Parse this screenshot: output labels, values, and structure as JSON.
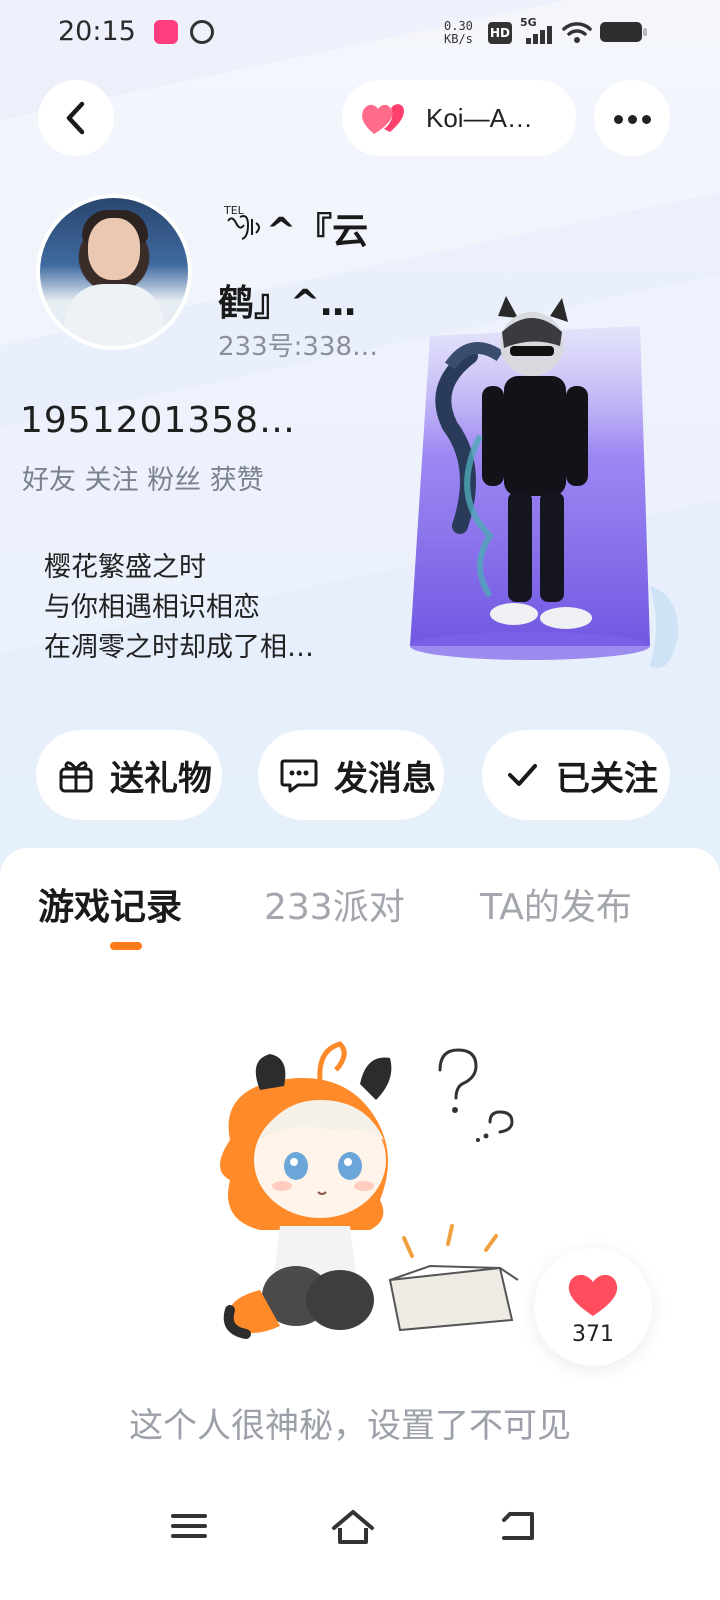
{
  "status_bar": {
    "time": "20:15",
    "net_speed_value": "0.30",
    "net_speed_unit": "KB/s",
    "hd_label": "HD",
    "network_label": "5G",
    "icons": [
      "app-notification-icon",
      "vpn-icon",
      "signal-icon",
      "wifi-icon",
      "battery-icon"
    ]
  },
  "header": {
    "back_icon": "chevron-left-icon",
    "couple_label": "Koi—A…",
    "couple_icon": "double-heart-icon",
    "more_icon": "more-dots-icon"
  },
  "profile": {
    "tel_mark": "TEL",
    "nickname_line1": "^『云",
    "nickname_line2": "鹤』^…",
    "user_id": "233号:338…",
    "stat_number": "1951201358…",
    "stat_labels": "好友 关注 粉丝 获赞",
    "bio_lines": [
      "樱花繁盛之时",
      "与你相遇相识相恋",
      "在凋零之时却成了相…"
    ]
  },
  "actions": {
    "gift": "送礼物",
    "message": "发消息",
    "follow": "已关注"
  },
  "tabs": {
    "items": [
      "游戏记录",
      "233派对",
      "TA的发布"
    ],
    "active_index": 0
  },
  "empty_state": {
    "message": "这个人很神秘，设置了不可见"
  },
  "like_widget": {
    "count": "371"
  },
  "colors": {
    "accent": "#ff7a1a",
    "heart": "#ff4d5e",
    "muted_text": "#9ca0a8"
  },
  "nav": {
    "icons": [
      "menu-icon",
      "home-icon",
      "back-icon"
    ]
  }
}
